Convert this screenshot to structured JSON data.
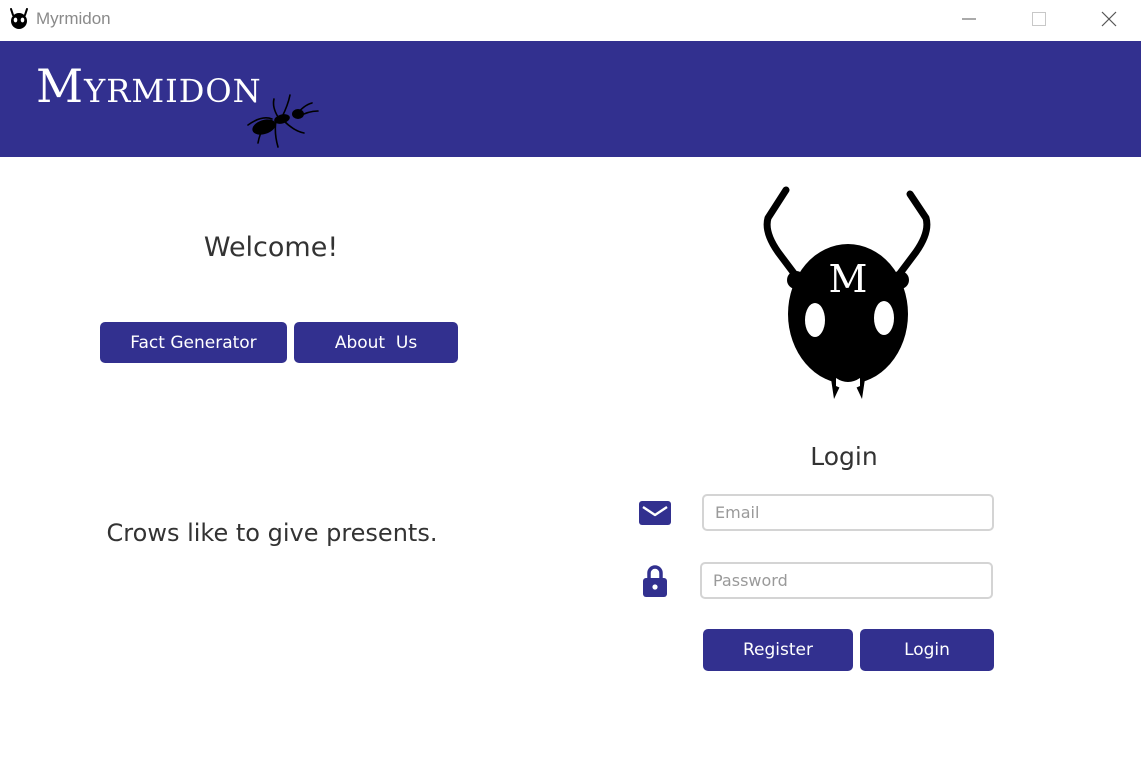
{
  "window": {
    "title": "Myrmidon"
  },
  "header": {
    "logo_text": "Myrmidon"
  },
  "left_panel": {
    "welcome": "Welcome!",
    "fact_button": "Fact Generator",
    "about_button": "About  Us",
    "fact_text": "Crows like to give presents."
  },
  "login": {
    "title": "Login",
    "mascot_letter": "M",
    "email_placeholder": "Email",
    "email_value": "",
    "password_placeholder": "Password",
    "password_value": "",
    "register_button": "Register",
    "login_button": "Login"
  },
  "icons": {
    "app": "ant-head-icon",
    "minimize": "minimize-icon",
    "maximize": "maximize-icon",
    "close": "close-icon",
    "mail": "mail-icon",
    "lock": "lock-icon"
  },
  "colors": {
    "brand": "#32308f",
    "text": "#333333",
    "button_text": "#ffffff"
  }
}
